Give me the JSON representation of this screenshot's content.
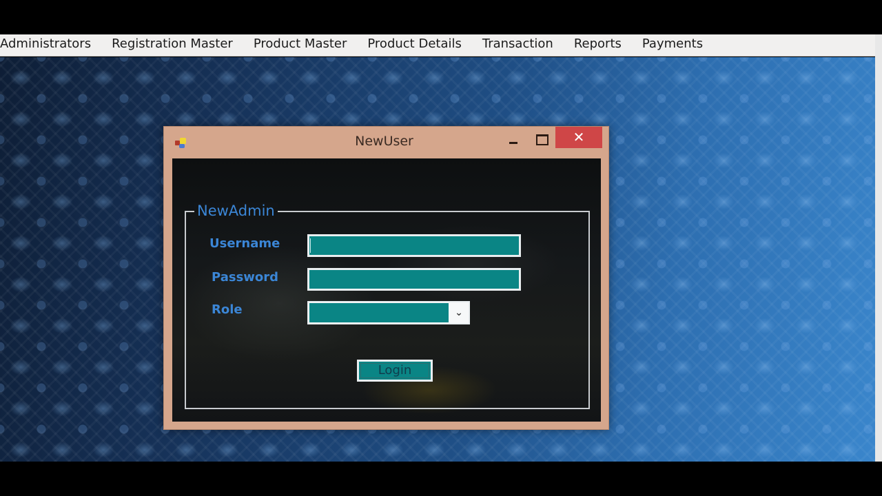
{
  "menubar": {
    "items": [
      {
        "label": "Administrators"
      },
      {
        "label": "Registration Master"
      },
      {
        "label": "Product Master"
      },
      {
        "label": "Product Details"
      },
      {
        "label": "Transaction"
      },
      {
        "label": "Reports"
      },
      {
        "label": "Payments"
      }
    ]
  },
  "window": {
    "title": "NewUser",
    "app_icon": "winforms-app-icon",
    "minimize_icon": "minimize-icon",
    "maximize_icon": "maximize-icon",
    "close_label": "✕",
    "close_color": "#cf4647",
    "frame_color": "#d5a68c"
  },
  "form": {
    "group_title": "NewAdmin",
    "username": {
      "label": "Username",
      "value": ""
    },
    "password": {
      "label": "Password",
      "value": ""
    },
    "role": {
      "label": "Role",
      "selected": "",
      "arrow": "⌄"
    },
    "login_label": "Login",
    "field_color": "#0a8585",
    "label_color": "#3b86d6"
  }
}
